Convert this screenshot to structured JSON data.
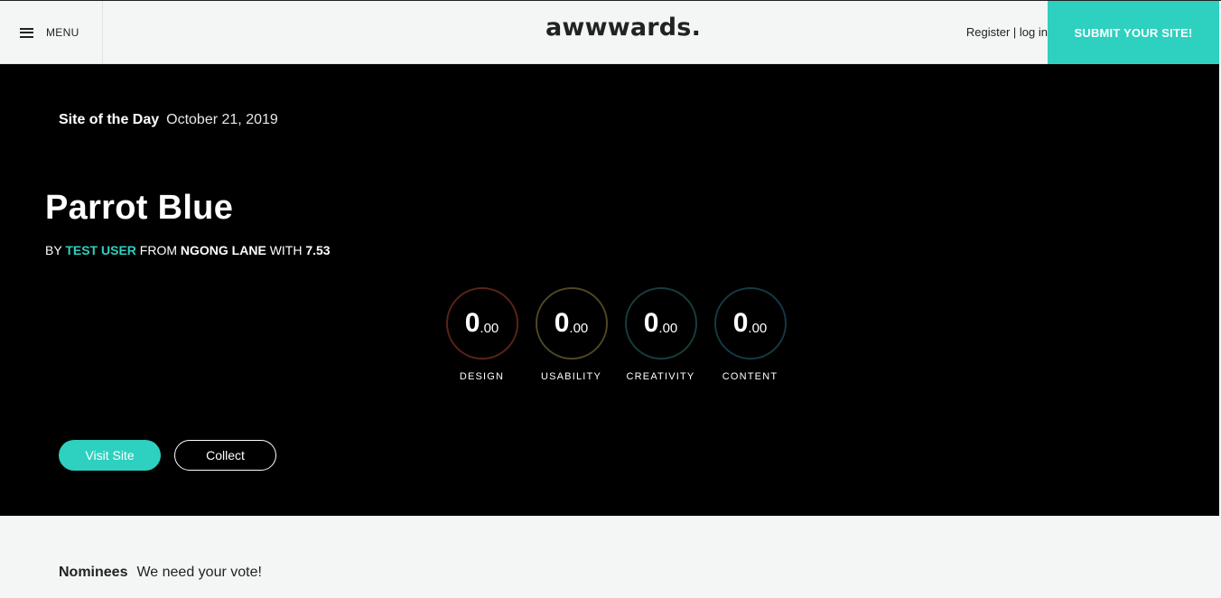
{
  "header": {
    "menu_label": "MENU",
    "logo": "awwwards.",
    "register_label": "Register",
    "separator": "|",
    "login_label": "log in",
    "submit_label": "SUBMIT YOUR SITE!"
  },
  "hero": {
    "badge": "Site of the Day",
    "date": "October 21, 2019",
    "title": "Parrot Blue",
    "byline": {
      "by": "BY",
      "author": "TEST USER",
      "from": "FROM",
      "place": "NGONG LANE",
      "with": "WITH",
      "score": "7.53"
    },
    "scores": [
      {
        "label": "DESIGN",
        "whole": "0",
        "decimal": ".00",
        "ring_color": "#5a2418"
      },
      {
        "label": "USABILITY",
        "whole": "0",
        "decimal": ".00",
        "ring_color": "#4e4823"
      },
      {
        "label": "CREATIVITY",
        "whole": "0",
        "decimal": ".00",
        "ring_color": "#163e3c"
      },
      {
        "label": "CONTENT",
        "whole": "0",
        "decimal": ".00",
        "ring_color": "#143a44"
      }
    ],
    "visit_label": "Visit Site",
    "collect_label": "Collect"
  },
  "nominees": {
    "title": "Nominees",
    "subtitle": "We need your vote!"
  },
  "colors": {
    "accent": "#2ed0bf",
    "hero_bg": "#000000",
    "page_bg": "#f4f6f5"
  }
}
